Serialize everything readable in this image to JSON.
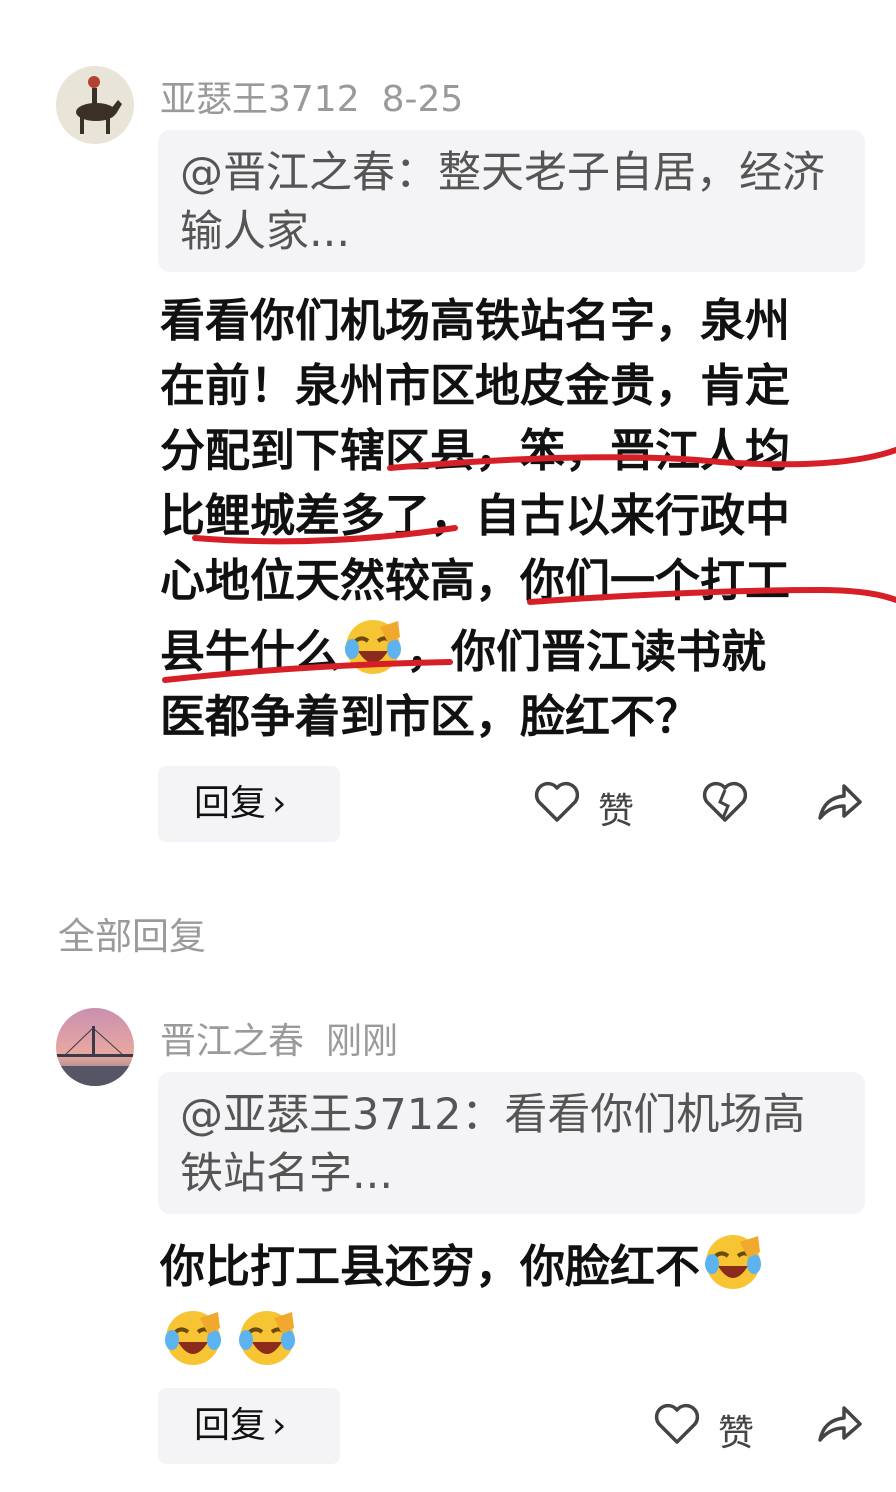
{
  "comments": [
    {
      "author": "亚瑟王3712",
      "time": "8-25",
      "quote": "@晋江之春：整天老子自居，经济输人家...",
      "text_lines": [
        "看看你们机场高铁站名字，泉州",
        "在前！泉州市区地皮金贵，肯定",
        "分配到下辖区县，笨，晋江人均",
        "比鲤城差多了，自古以来行政中",
        "心地位天然较高，你们一个打工"
      ],
      "text_line6_a": "县牛什么",
      "text_line6_b": "，你们晋江读书就",
      "text_line7": "医都争着到市区，脸红不？",
      "reply_label": "回复",
      "like_label": "赞"
    },
    {
      "author": "晋江之春",
      "time": "刚刚",
      "quote": "@亚瑟王3712：看看你们机场高铁站名字...",
      "text": "你比打工县还穷，你脸红不",
      "reply_label": "回复",
      "like_label": "赞"
    }
  ],
  "section_title": "全部回复",
  "icons": {
    "emoji": "laughing-crying-emoji-icon",
    "like": "heart-icon",
    "dislike": "broken-heart-icon",
    "share": "share-arrow-icon",
    "chevron": "chevron-right-icon"
  },
  "colors": {
    "underline": "#d61f26",
    "meta": "#9a9a9a",
    "quote_bg": "#f4f4f6"
  }
}
